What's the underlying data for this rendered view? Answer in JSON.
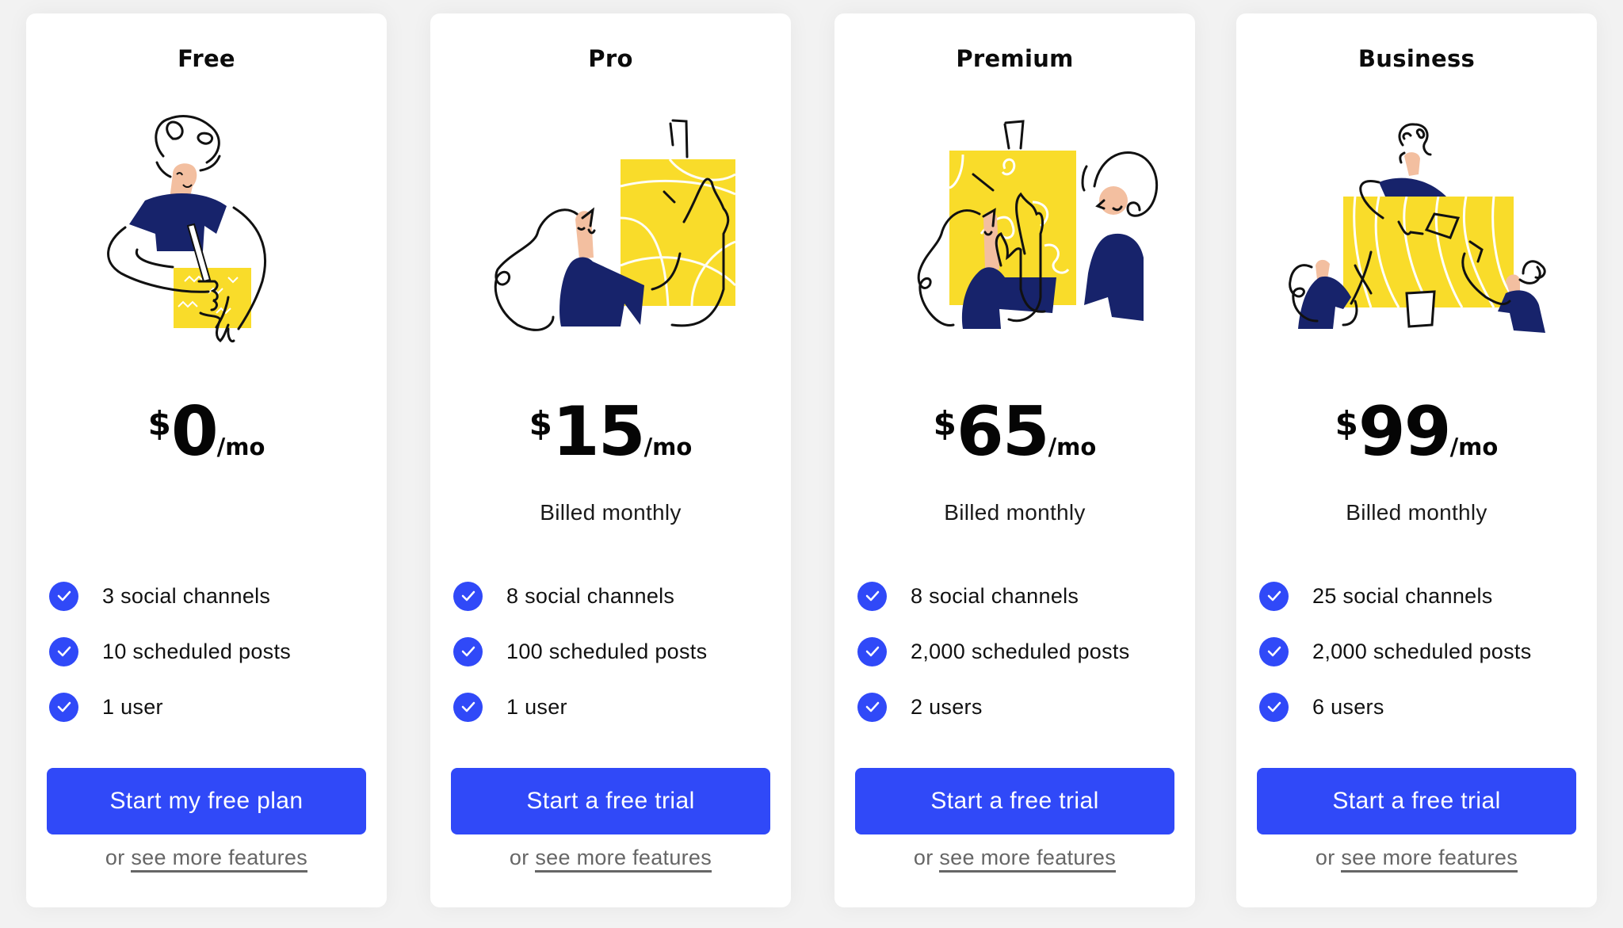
{
  "colors": {
    "accent": "#3049f8",
    "navy": "#17236b",
    "yellow": "#f9dc2a",
    "skin": "#f3bfa0",
    "background": "#f2f2f2",
    "card": "#ffffff",
    "link": "#666666"
  },
  "plans": [
    {
      "name": "Free",
      "illustration": "person-drawing-on-note-illustration",
      "currency": "$",
      "amount": "0",
      "period": "/mo",
      "billing": "",
      "features": [
        "3 social channels",
        "10 scheduled posts",
        "1 user"
      ],
      "cta_label": "Start my free plan",
      "more_prefix": "or ",
      "more_link": "see more features"
    },
    {
      "name": "Pro",
      "illustration": "person-touching-board-illustration",
      "currency": "$",
      "amount": "15",
      "period": "/mo",
      "billing": "Billed monthly",
      "features": [
        "8 social channels",
        "100 scheduled posts",
        "1 user"
      ],
      "cta_label": "Start a free trial",
      "more_prefix": "or ",
      "more_link": "see more features"
    },
    {
      "name": "Premium",
      "illustration": "two-people-at-board-illustration",
      "currency": "$",
      "amount": "65",
      "period": "/mo",
      "billing": "Billed monthly",
      "features": [
        "8 social channels",
        "2,000 scheduled posts",
        "2 users"
      ],
      "cta_label": "Start a free trial",
      "more_prefix": "or ",
      "more_link": "see more features"
    },
    {
      "name": "Business",
      "illustration": "team-around-table-illustration",
      "currency": "$",
      "amount": "99",
      "period": "/mo",
      "billing": "Billed monthly",
      "features": [
        "25 social channels",
        "2,000 scheduled posts",
        "6 users"
      ],
      "cta_label": "Start a free trial",
      "more_prefix": "or ",
      "more_link": "see more features"
    }
  ]
}
